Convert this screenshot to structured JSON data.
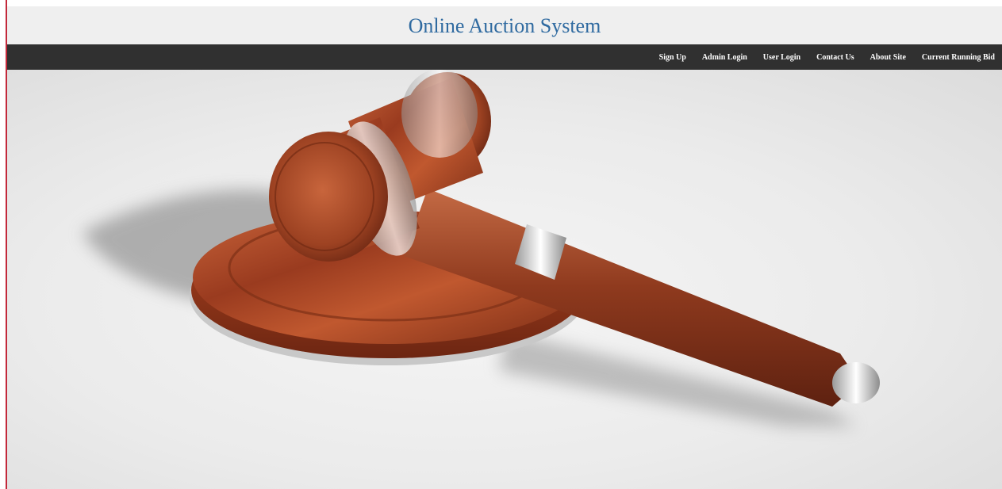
{
  "header": {
    "title": "Online Auction System"
  },
  "nav": {
    "items": [
      {
        "label": "Sign Up"
      },
      {
        "label": "Admin Login"
      },
      {
        "label": "User Login"
      },
      {
        "label": "Contact Us"
      },
      {
        "label": "About Site"
      },
      {
        "label": "Current Running Bid"
      }
    ]
  },
  "hero": {
    "image": "gavel-and-sound-block-photo"
  },
  "colors": {
    "title": "#2f6aa0",
    "navbar": "#303030",
    "left_rule": "#c2283a",
    "wood": "#a8492a"
  }
}
